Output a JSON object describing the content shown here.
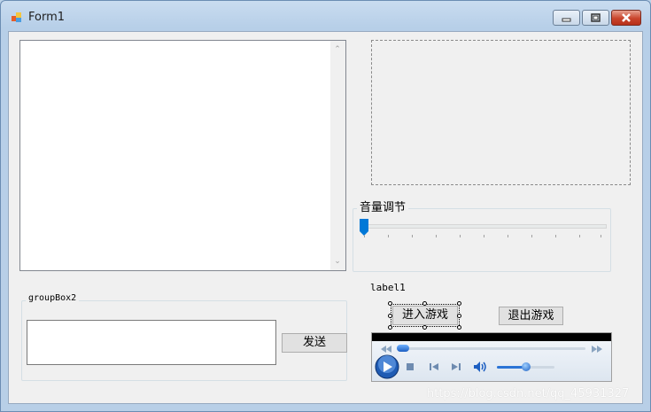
{
  "window": {
    "title": "Form1"
  },
  "volume_group": {
    "title": "音量调节",
    "value_percent": 0
  },
  "label1": {
    "text": "label1"
  },
  "buttons": {
    "enter_game": "进入游戏",
    "exit_game": "退出游戏",
    "send": "发送"
  },
  "groupbox2": {
    "title": "groupBox2"
  },
  "media_player": {
    "volume_percent": 50,
    "seek_percent": 2
  },
  "watermark": {
    "text": "https://blog.csdn.net/qq_45931327"
  },
  "colors": {
    "accent": "#0078d7",
    "close_button": "#c9452c"
  }
}
